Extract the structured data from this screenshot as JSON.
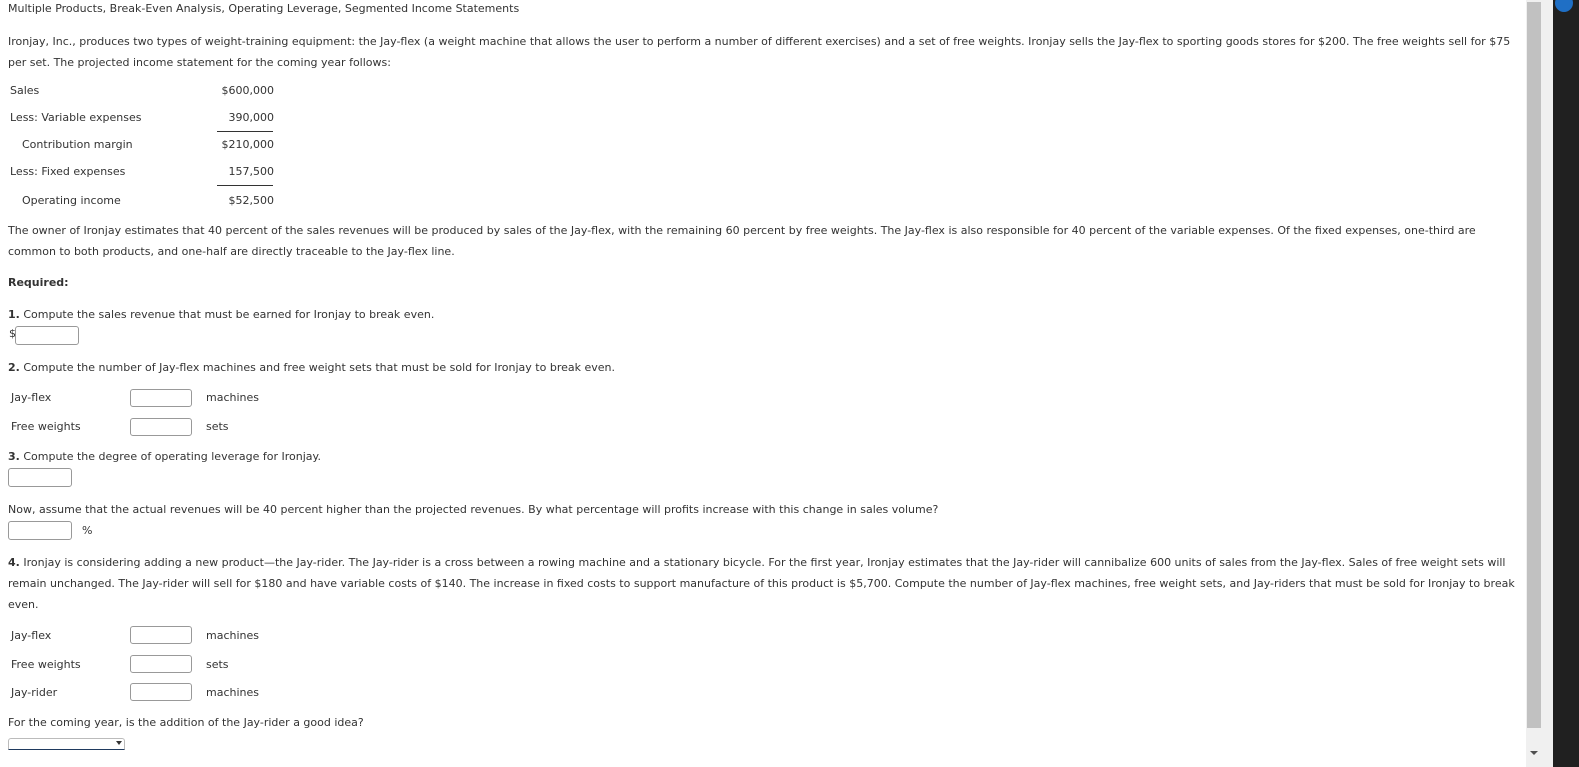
{
  "title": "Multiple Products, Break-Even Analysis, Operating Leverage, Segmented Income Statements",
  "intro": "Ironjay, Inc., produces two types of weight-training equipment: the Jay-flex (a weight machine that allows the user to perform a number of different exercises) and a set of free weights. Ironjay sells the Jay-flex to sporting goods stores for $200. The free weights sell for $75 per set. The projected income statement for the coming year follows:",
  "income_statement": [
    {
      "label": "Sales",
      "value": "$600,000"
    },
    {
      "label": "Less: Variable expenses",
      "value": "390,000"
    },
    {
      "label": "Contribution margin",
      "value": "$210,000"
    },
    {
      "label": "Less: Fixed expenses",
      "value": "157,500"
    },
    {
      "label": "Operating income",
      "value": "$52,500"
    }
  ],
  "owner_paragraph": "The owner of Ironjay estimates that 40 percent of the sales revenues will be produced by sales of the Jay-flex, with the remaining 60 percent by free weights. The Jay-flex is also responsible for 40 percent of the variable expenses. Of the fixed expenses, one-third are common to both products, and one-half are directly traceable to the Jay-flex line.",
  "required_label": "Required:",
  "q1": {
    "num": "1.",
    "text": " Compute the sales revenue that must be earned for Ironjay to break even.",
    "prefix": "$",
    "value": ""
  },
  "q2": {
    "num": "2.",
    "text": " Compute the number of Jay-flex machines and free weight sets that must be sold for Ironjay to break even.",
    "rows": [
      {
        "label": "Jay-flex",
        "unit": "machines",
        "value": ""
      },
      {
        "label": "Free weights",
        "unit": "sets",
        "value": ""
      }
    ]
  },
  "q3": {
    "num": "3.",
    "text": " Compute the degree of operating leverage for Ironjay.",
    "value": "",
    "followup": "Now, assume that the actual revenues will be 40 percent higher than the projected revenues. By what percentage will profits increase with this change in sales volume?",
    "followup_value": "",
    "followup_unit": "%"
  },
  "q4": {
    "num": "4.",
    "text": " Ironjay is considering adding a new product—the Jay-rider. The Jay-rider is a cross between a rowing machine and a stationary bicycle. For the first year, Ironjay estimates that the Jay-rider will cannibalize 600 units of sales from the Jay-flex. Sales of free weight sets will remain unchanged. The Jay-rider will sell for $180 and have variable costs of $140. The increase in fixed costs to support manufacture of this product is $5,700. Compute the number of Jay-flex machines, free weight sets, and Jay-riders that must be sold for Ironjay to break even.",
    "rows": [
      {
        "label": "Jay-flex",
        "unit": "machines",
        "value": ""
      },
      {
        "label": "Free weights",
        "unit": "sets",
        "value": ""
      },
      {
        "label": "Jay-rider",
        "unit": "machines",
        "value": ""
      }
    ],
    "good_idea_question": "For the coming year, is the addition of the Jay-rider a good idea?",
    "good_idea_selected": ""
  },
  "icons": {
    "select_arrow": "chevron-down-icon",
    "scroll_down": "scroll-down-arrow-icon"
  }
}
